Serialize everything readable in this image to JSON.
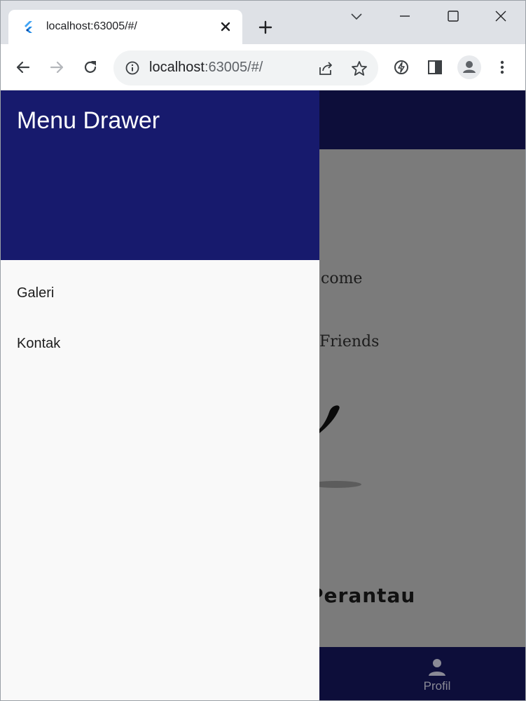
{
  "browser": {
    "tab_title": "localhost:63005/#/",
    "url_host": "localhost",
    "url_rest": ":63005/#/"
  },
  "app": {
    "welcome_lines": [
      "come",
      "Friends"
    ],
    "brand_title": "Perantau",
    "bottom_nav": {
      "profil_label": "Profil"
    }
  },
  "drawer": {
    "title": "Menu Drawer",
    "items": [
      {
        "label": "Galeri"
      },
      {
        "label": "Kontak"
      }
    ]
  },
  "colors": {
    "drawer_header": "#171a6d",
    "app_bar": "#0d0e3a",
    "scrim_page": "#7b7b7b",
    "drawer_body": "#f9f9f9"
  }
}
